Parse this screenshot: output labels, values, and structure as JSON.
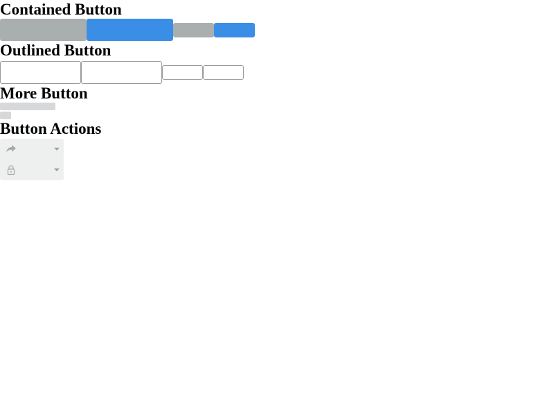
{
  "sections": {
    "contained": {
      "title": "Contained Button"
    },
    "outlined": {
      "title": "Outlined Button"
    },
    "more": {
      "title": "More Button"
    },
    "actions": {
      "title": "Button Actions"
    }
  },
  "contained_buttons": [
    {
      "label": "",
      "color": "#a9aeae",
      "size": "large"
    },
    {
      "label": "",
      "color": "#3a8ee6",
      "size": "large"
    },
    {
      "label": "",
      "color": "#a9aeae",
      "size": "small"
    },
    {
      "label": "",
      "color": "#3a8ee6",
      "size": "small"
    }
  ],
  "outlined_buttons": [
    {
      "label": "",
      "border_color": "#9a9a9a",
      "size": "large"
    },
    {
      "label": "",
      "border_color": "#9a9a9a",
      "size": "large"
    },
    {
      "label": "",
      "border_color": "#9a9a9a",
      "size": "small"
    },
    {
      "label": "",
      "border_color": "#9a9a9a",
      "size": "small"
    }
  ],
  "more_button": {
    "bar_color": "#d6d8da"
  },
  "action_buttons": [
    {
      "icon": "share-forward-icon",
      "dropdown": "caret-down-icon"
    },
    {
      "icon": "lock-icon",
      "dropdown": "caret-down-icon"
    }
  ],
  "colors": {
    "gray": "#a9aeae",
    "blue": "#3a8ee6",
    "outline": "#9a9a9a",
    "more_bar": "#d6d8da",
    "action_bg": "#eef0f0",
    "action_icon": "#a9a9a9"
  }
}
